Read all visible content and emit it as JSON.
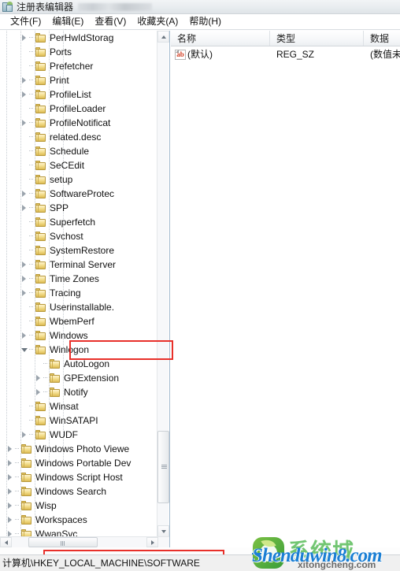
{
  "window": {
    "title": "注册表编辑器",
    "icon": "registry-editor-icon",
    "title_redacted": true
  },
  "menubar": {
    "items": [
      {
        "label": "文件(F)",
        "name": "menu-file"
      },
      {
        "label": "编辑(E)",
        "name": "menu-edit"
      },
      {
        "label": "查看(V)",
        "name": "menu-view"
      },
      {
        "label": "收藏夹(A)",
        "name": "menu-favorites"
      },
      {
        "label": "帮助(H)",
        "name": "menu-help"
      }
    ]
  },
  "tree": {
    "scrollbars": {
      "vertical": true,
      "horizontal": true
    },
    "items": [
      {
        "label": "PerHwIdStorag",
        "depth": 4,
        "twisty": "closed"
      },
      {
        "label": "Ports",
        "depth": 4,
        "twisty": "none"
      },
      {
        "label": "Prefetcher",
        "depth": 4,
        "twisty": "none"
      },
      {
        "label": "Print",
        "depth": 4,
        "twisty": "closed"
      },
      {
        "label": "ProfileList",
        "depth": 4,
        "twisty": "closed"
      },
      {
        "label": "ProfileLoader",
        "depth": 4,
        "twisty": "none"
      },
      {
        "label": "ProfileNotificat",
        "depth": 4,
        "twisty": "closed"
      },
      {
        "label": "related.desc",
        "depth": 4,
        "twisty": "none"
      },
      {
        "label": "Schedule",
        "depth": 4,
        "twisty": "none"
      },
      {
        "label": "SeCEdit",
        "depth": 4,
        "twisty": "none"
      },
      {
        "label": "setup",
        "depth": 4,
        "twisty": "none"
      },
      {
        "label": "SoftwareProtec",
        "depth": 4,
        "twisty": "closed"
      },
      {
        "label": "SPP",
        "depth": 4,
        "twisty": "closed"
      },
      {
        "label": "Superfetch",
        "depth": 4,
        "twisty": "none"
      },
      {
        "label": "Svchost",
        "depth": 4,
        "twisty": "none"
      },
      {
        "label": "SystemRestore",
        "depth": 4,
        "twisty": "none"
      },
      {
        "label": "Terminal Server",
        "depth": 4,
        "twisty": "closed"
      },
      {
        "label": "Time Zones",
        "depth": 4,
        "twisty": "closed"
      },
      {
        "label": "Tracing",
        "depth": 4,
        "twisty": "closed"
      },
      {
        "label": "Userinstallable.",
        "depth": 4,
        "twisty": "none"
      },
      {
        "label": "WbemPerf",
        "depth": 4,
        "twisty": "none"
      },
      {
        "label": "Windows",
        "depth": 4,
        "twisty": "closed"
      },
      {
        "label": "Winlogon",
        "depth": 4,
        "twisty": "open",
        "highlighted": true
      },
      {
        "label": "AutoLogon",
        "depth": 5,
        "twisty": "none"
      },
      {
        "label": "GPExtension",
        "depth": 5,
        "twisty": "closed"
      },
      {
        "label": "Notify",
        "depth": 5,
        "twisty": "closed"
      },
      {
        "label": "Winsat",
        "depth": 4,
        "twisty": "none"
      },
      {
        "label": "WinSATAPI",
        "depth": 4,
        "twisty": "none"
      },
      {
        "label": "WUDF",
        "depth": 4,
        "twisty": "closed"
      },
      {
        "label": "Windows Photo Viewe",
        "depth": 3,
        "twisty": "closed"
      },
      {
        "label": "Windows Portable Dev",
        "depth": 3,
        "twisty": "closed"
      },
      {
        "label": "Windows Script Host",
        "depth": 3,
        "twisty": "closed"
      },
      {
        "label": "Windows Search",
        "depth": 3,
        "twisty": "closed"
      },
      {
        "label": "Wisp",
        "depth": 3,
        "twisty": "closed"
      },
      {
        "label": "Workspaces",
        "depth": 3,
        "twisty": "closed"
      },
      {
        "label": "WwanSvc",
        "depth": 3,
        "twisty": "closed"
      }
    ]
  },
  "list": {
    "columns": [
      {
        "label": "名称",
        "name": "column-name"
      },
      {
        "label": "类型",
        "name": "column-type"
      },
      {
        "label": "数据",
        "name": "column-data"
      }
    ],
    "rows": [
      {
        "icon": "ab-string-icon",
        "icon_text": "ab",
        "name": "(默认)",
        "type": "REG_SZ",
        "data": "(数值未"
      }
    ]
  },
  "statusbar": {
    "path": "计算机\\HKEY_LOCAL_MACHINE\\SOFTWARE"
  },
  "annotations": {
    "highlight_color": "#e8302a",
    "boxes": [
      {
        "name": "winlogon-highlight",
        "target": "Winlogon"
      },
      {
        "name": "statusbar-path-highlight",
        "target": "计算机\\HKEY_LOCAL_MACHINE\\SOFTWARE"
      }
    ]
  },
  "watermark": {
    "main": "Shenduwin8.com",
    "cn": "系统城",
    "sub": "xitongcheng.com"
  }
}
